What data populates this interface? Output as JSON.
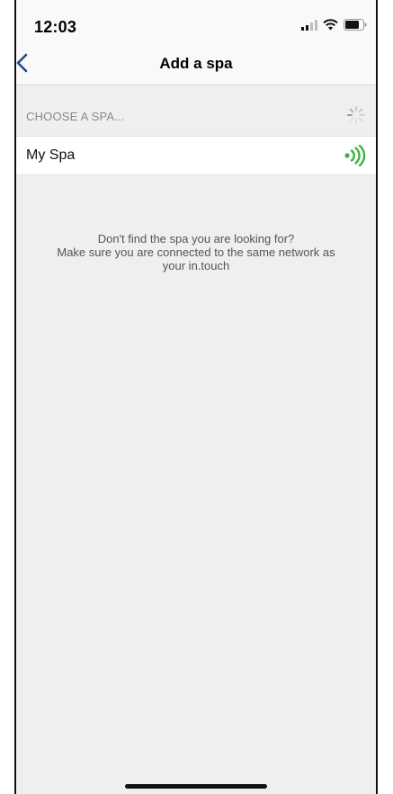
{
  "status_bar": {
    "time": "12:03",
    "icons": [
      "cellular-signal-icon",
      "wifi-icon",
      "battery-icon"
    ]
  },
  "nav": {
    "back_icon": "chevron-left-icon",
    "title": "Add a spa"
  },
  "section": {
    "label": "CHOOSE A SPA...",
    "loading_icon": "spinner-icon"
  },
  "spas": [
    {
      "name": "My Spa",
      "icon": "signal-strength-icon"
    }
  ],
  "help": {
    "line1": "Don't find the spa you are looking for?",
    "line2": "Make sure you are connected to the same network as",
    "line3": "your in.touch"
  },
  "colors": {
    "accent": "#1f4a8a",
    "signal": "#3cb43c",
    "background": "#efefef"
  }
}
